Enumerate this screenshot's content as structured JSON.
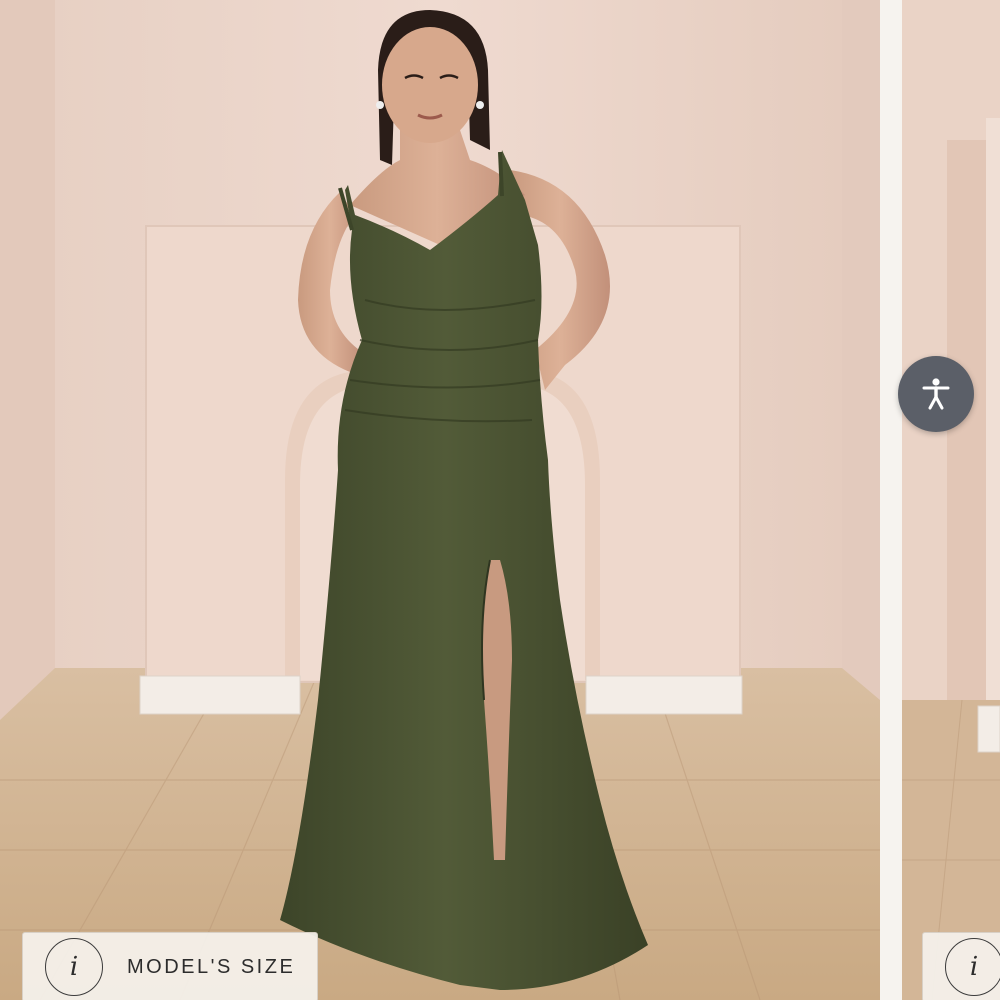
{
  "gallery": {
    "main_image": {
      "dress_color": "#4a5233",
      "wall_color": "#ecd5c9",
      "floor_color": "#d2b596"
    },
    "model_size_badge": {
      "icon": "info-icon",
      "icon_text": "i",
      "label": "MODEL'S SIZE"
    },
    "next_slide_badge": {
      "icon": "info-icon",
      "icon_text": "i"
    }
  },
  "accessibility": {
    "icon": "accessibility-person-icon",
    "color": "#5b5f68"
  }
}
